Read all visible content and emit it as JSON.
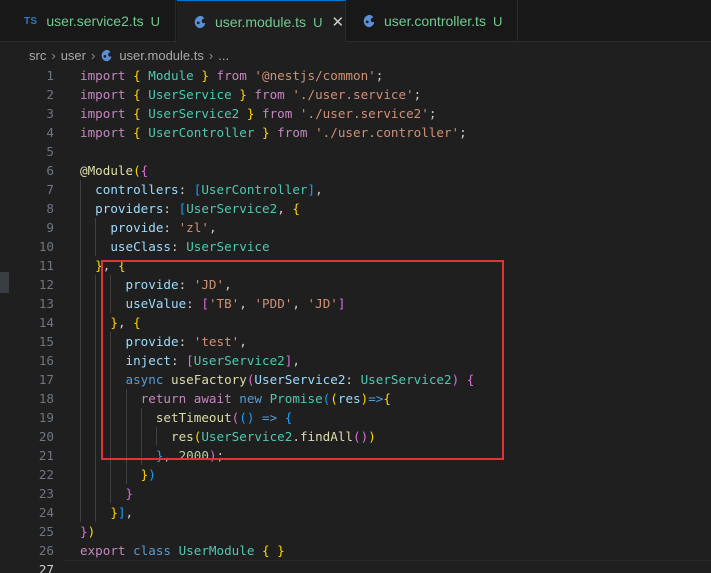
{
  "tabs": [
    {
      "icon": "TS",
      "label": "user.service2.ts",
      "state": "U",
      "active": false
    },
    {
      "icon": "nestjs-icon",
      "label": "user.module.ts",
      "state": "U",
      "active": true,
      "close": "✕"
    },
    {
      "icon": "nestjs-icon",
      "label": "user.controller.ts",
      "state": "U",
      "active": false
    }
  ],
  "breadcrumb": {
    "items": [
      "src",
      "user",
      "user.module.ts",
      "..."
    ],
    "separator": "›"
  },
  "editor": {
    "line_numbers": [
      "1",
      "2",
      "3",
      "4",
      "5",
      "6",
      "7",
      "8",
      "9",
      "10",
      "11",
      "12",
      "13",
      "14",
      "15",
      "16",
      "17",
      "18",
      "19",
      "20",
      "21",
      "22",
      "23",
      "24",
      "25",
      "26",
      "27"
    ],
    "current_line": "27",
    "lines": [
      [
        [
          "kw",
          "import "
        ],
        [
          "b1",
          "{ "
        ],
        [
          "ty",
          "Module"
        ],
        [
          "b1",
          " }"
        ],
        [
          "kw",
          " from "
        ],
        [
          "st",
          "'@nestjs/common'"
        ],
        [
          "tx",
          ";"
        ]
      ],
      [
        [
          "kw",
          "import "
        ],
        [
          "b1",
          "{ "
        ],
        [
          "ty",
          "UserService"
        ],
        [
          "b1",
          " }"
        ],
        [
          "kw",
          " from "
        ],
        [
          "st",
          "'./user.service'"
        ],
        [
          "tx",
          ";"
        ]
      ],
      [
        [
          "kw",
          "import "
        ],
        [
          "b1",
          "{ "
        ],
        [
          "ty",
          "UserService2"
        ],
        [
          "b1",
          " }"
        ],
        [
          "kw",
          " from "
        ],
        [
          "st",
          "'./user.service2'"
        ],
        [
          "tx",
          ";"
        ]
      ],
      [
        [
          "kw",
          "import "
        ],
        [
          "b1",
          "{ "
        ],
        [
          "ty",
          "UserController"
        ],
        [
          "b1",
          " }"
        ],
        [
          "kw",
          " from "
        ],
        [
          "st",
          "'./user.controller'"
        ],
        [
          "tx",
          ";"
        ]
      ],
      [],
      [
        [
          "fn",
          "@Module"
        ],
        [
          "b1",
          "("
        ],
        [
          "b2",
          "{"
        ]
      ],
      [
        [
          "tx",
          "  "
        ],
        [
          "pr",
          "controllers"
        ],
        [
          "tx",
          ": "
        ],
        [
          "b3",
          "["
        ],
        [
          "ty",
          "UserController"
        ],
        [
          "b3",
          "]"
        ],
        [
          "tx",
          ","
        ]
      ],
      [
        [
          "tx",
          "  "
        ],
        [
          "pr",
          "providers"
        ],
        [
          "tx",
          ": "
        ],
        [
          "b3",
          "["
        ],
        [
          "ty",
          "UserService2"
        ],
        [
          "tx",
          ", "
        ],
        [
          "b1",
          "{"
        ]
      ],
      [
        [
          "tx",
          "    "
        ],
        [
          "pr",
          "provide"
        ],
        [
          "tx",
          ": "
        ],
        [
          "st",
          "'zl'"
        ],
        [
          "tx",
          ","
        ]
      ],
      [
        [
          "tx",
          "    "
        ],
        [
          "pr",
          "useClass"
        ],
        [
          "tx",
          ": "
        ],
        [
          "ty",
          "UserService"
        ]
      ],
      [
        [
          "tx",
          "  "
        ],
        [
          "b1",
          "}"
        ],
        [
          "tx",
          ", "
        ],
        [
          "b1",
          "{"
        ]
      ],
      [
        [
          "tx",
          "      "
        ],
        [
          "pr",
          "provide"
        ],
        [
          "tx",
          ": "
        ],
        [
          "st",
          "'JD'"
        ],
        [
          "tx",
          ","
        ]
      ],
      [
        [
          "tx",
          "      "
        ],
        [
          "pr",
          "useValue"
        ],
        [
          "tx",
          ": "
        ],
        [
          "b2",
          "["
        ],
        [
          "st",
          "'TB'"
        ],
        [
          "tx",
          ", "
        ],
        [
          "st",
          "'PDD'"
        ],
        [
          "tx",
          ", "
        ],
        [
          "st",
          "'JD'"
        ],
        [
          "b2",
          "]"
        ]
      ],
      [
        [
          "tx",
          "    "
        ],
        [
          "b1",
          "}"
        ],
        [
          "tx",
          ", "
        ],
        [
          "b1",
          "{"
        ]
      ],
      [
        [
          "tx",
          "      "
        ],
        [
          "pr",
          "provide"
        ],
        [
          "tx",
          ": "
        ],
        [
          "st",
          "'test'"
        ],
        [
          "tx",
          ","
        ]
      ],
      [
        [
          "tx",
          "      "
        ],
        [
          "pr",
          "inject"
        ],
        [
          "tx",
          ": "
        ],
        [
          "b2",
          "["
        ],
        [
          "ty",
          "UserService2"
        ],
        [
          "b2",
          "]"
        ],
        [
          "tx",
          ","
        ]
      ],
      [
        [
          "tx",
          "      "
        ],
        [
          "kb",
          "async "
        ],
        [
          "fn",
          "useFactory"
        ],
        [
          "b2",
          "("
        ],
        [
          "pr",
          "UserService2"
        ],
        [
          "tx",
          ": "
        ],
        [
          "ty",
          "UserService2"
        ],
        [
          "b2",
          ")"
        ],
        [
          "tx",
          " "
        ],
        [
          "b2",
          "{"
        ]
      ],
      [
        [
          "tx",
          "        "
        ],
        [
          "kw",
          "return "
        ],
        [
          "kw",
          "await "
        ],
        [
          "kb",
          "new "
        ],
        [
          "ty",
          "Promise"
        ],
        [
          "b3",
          "("
        ],
        [
          "b1",
          "("
        ],
        [
          "pr",
          "res"
        ],
        [
          "b1",
          ")"
        ],
        [
          "kb",
          "=>"
        ],
        [
          "b1",
          "{"
        ]
      ],
      [
        [
          "tx",
          "          "
        ],
        [
          "fn",
          "setTimeout"
        ],
        [
          "b2",
          "("
        ],
        [
          "b3",
          "()"
        ],
        [
          "tx",
          " "
        ],
        [
          "kb",
          "=>"
        ],
        [
          "tx",
          " "
        ],
        [
          "b3",
          "{"
        ]
      ],
      [
        [
          "tx",
          "            "
        ],
        [
          "fn",
          "res"
        ],
        [
          "b1",
          "("
        ],
        [
          "ty",
          "UserService2"
        ],
        [
          "tx",
          "."
        ],
        [
          "fn",
          "findAll"
        ],
        [
          "b2",
          "()"
        ],
        [
          "b1",
          ")"
        ]
      ],
      [
        [
          "tx",
          "          "
        ],
        [
          "b3",
          "}"
        ],
        [
          "tx",
          ", "
        ],
        [
          "nu",
          "2000"
        ],
        [
          "b2",
          ")"
        ],
        [
          "tx",
          ";"
        ]
      ],
      [
        [
          "tx",
          "        "
        ],
        [
          "b1",
          "}"
        ],
        [
          "b3",
          ")"
        ]
      ],
      [
        [
          "tx",
          "      "
        ],
        [
          "b2",
          "}"
        ]
      ],
      [
        [
          "tx",
          "    "
        ],
        [
          "b1",
          "}"
        ],
        [
          "b3",
          "]"
        ],
        [
          "tx",
          ","
        ]
      ],
      [
        [
          "b2",
          "}"
        ],
        [
          "b1",
          ")"
        ]
      ],
      [
        [
          "kw",
          "export "
        ],
        [
          "kb",
          "class "
        ],
        [
          "ty",
          "UserModule"
        ],
        [
          "tx",
          " "
        ],
        [
          "b1",
          "{ }"
        ]
      ],
      []
    ]
  },
  "colors": {
    "highlight_box": "#e03434",
    "accent": "#0078d4"
  }
}
